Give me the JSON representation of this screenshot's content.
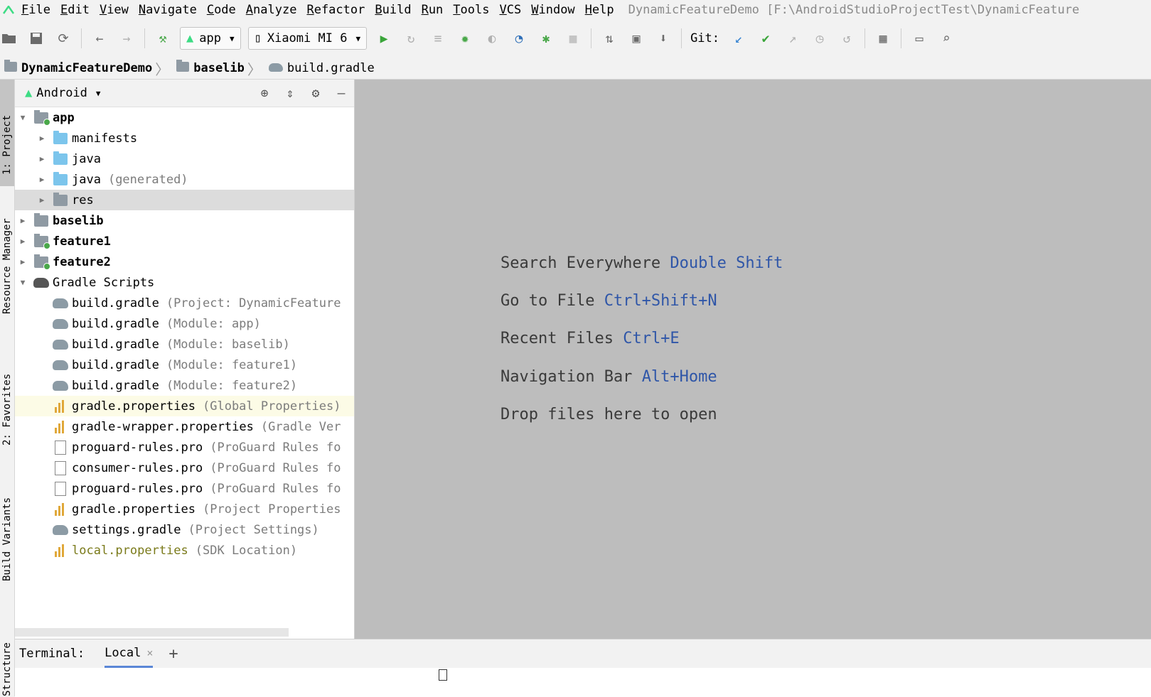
{
  "menu": {
    "items": [
      "File",
      "Edit",
      "View",
      "Navigate",
      "Code",
      "Analyze",
      "Refactor",
      "Build",
      "Run",
      "Tools",
      "VCS",
      "Window",
      "Help"
    ],
    "window_title": "DynamicFeatureDemo [F:\\AndroidStudioProjectTest\\DynamicFeature"
  },
  "toolbar": {
    "run_config": "app",
    "device": "Xiaomi MI 6",
    "git_label": "Git:"
  },
  "breadcrumb": {
    "project": "DynamicFeatureDemo",
    "module": "baselib",
    "file": "build.gradle"
  },
  "side_tabs": {
    "project": "1: Project",
    "resource_manager": "Resource Manager",
    "favorites": "2: Favorites",
    "build_variants": "Build Variants",
    "structure": "Structure"
  },
  "project_panel": {
    "view_mode": "Android",
    "tree": [
      {
        "label": "app",
        "hint": "",
        "level": 0,
        "expanded": true,
        "bold": true
      },
      {
        "label": "manifests",
        "hint": "",
        "level": 1,
        "expanded": false
      },
      {
        "label": "java",
        "hint": "",
        "level": 1,
        "expanded": false
      },
      {
        "label": "java",
        "hint": "(generated)",
        "level": 1,
        "expanded": false
      },
      {
        "label": "res",
        "hint": "",
        "level": 1,
        "expanded": false
      },
      {
        "label": "baselib",
        "hint": "",
        "level": 0,
        "expanded": false,
        "bold": true
      },
      {
        "label": "feature1",
        "hint": "",
        "level": 0,
        "expanded": false,
        "bold": true
      },
      {
        "label": "feature2",
        "hint": "",
        "level": 0,
        "expanded": false,
        "bold": true
      },
      {
        "label": "Gradle Scripts",
        "hint": "",
        "level": 0,
        "expanded": true
      },
      {
        "label": "build.gradle",
        "hint": "(Project: DynamicFeature",
        "level": 1
      },
      {
        "label": "build.gradle",
        "hint": "(Module: app)",
        "level": 1
      },
      {
        "label": "build.gradle",
        "hint": "(Module: baselib)",
        "level": 1
      },
      {
        "label": "build.gradle",
        "hint": "(Module: feature1)",
        "level": 1
      },
      {
        "label": "build.gradle",
        "hint": "(Module: feature2)",
        "level": 1
      },
      {
        "label": "gradle.properties",
        "hint": "(Global Properties)",
        "level": 1
      },
      {
        "label": "gradle-wrapper.properties",
        "hint": "(Gradle Ver",
        "level": 1
      },
      {
        "label": "proguard-rules.pro",
        "hint": "(ProGuard Rules fo",
        "level": 1
      },
      {
        "label": "consumer-rules.pro",
        "hint": "(ProGuard Rules fo",
        "level": 1
      },
      {
        "label": "proguard-rules.pro",
        "hint": "(ProGuard Rules fo",
        "level": 1
      },
      {
        "label": "gradle.properties",
        "hint": "(Project Properties",
        "level": 1
      },
      {
        "label": "settings.gradle",
        "hint": "(Project Settings)",
        "level": 1
      },
      {
        "label": "local.properties",
        "hint": "(SDK Location)",
        "level": 1
      }
    ]
  },
  "editor_hints": [
    {
      "text": "Search Everywhere",
      "shortcut": "Double Shift"
    },
    {
      "text": "Go to File",
      "shortcut": "Ctrl+Shift+N"
    },
    {
      "text": "Recent Files",
      "shortcut": "Ctrl+E"
    },
    {
      "text": "Navigation Bar",
      "shortcut": "Alt+Home"
    },
    {
      "text": "Drop files here to open",
      "shortcut": ""
    }
  ],
  "terminal": {
    "label": "Terminal:",
    "tab": "Local",
    "close_glyph": "×",
    "add_glyph": "+"
  }
}
